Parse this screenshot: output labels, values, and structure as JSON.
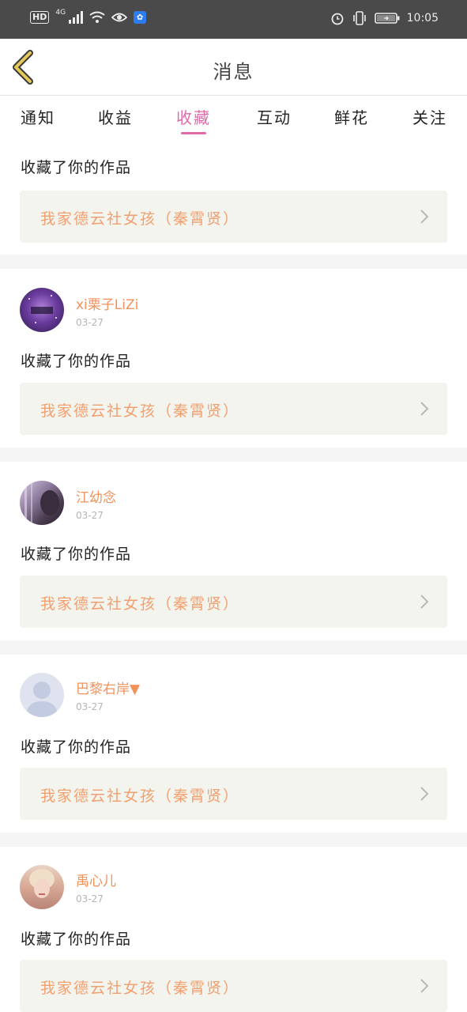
{
  "status_bar": {
    "hd": "HD",
    "network": "4G",
    "time": "10:05"
  },
  "header": {
    "title": "消息"
  },
  "tabs": [
    {
      "label": "通知"
    },
    {
      "label": "收益"
    },
    {
      "label": "收藏",
      "active": true
    },
    {
      "label": "互动"
    },
    {
      "label": "鲜花"
    },
    {
      "label": "关注"
    }
  ],
  "accent_color": "#e06aa8",
  "first_item": {
    "action": "收藏了你的作品",
    "work_title": "我家德云社女孩（秦霄贤）"
  },
  "items": [
    {
      "username": "xi栗子LiZi",
      "date": "03-27",
      "action": "收藏了你的作品",
      "work_title": "我家德云社女孩（秦霄贤）"
    },
    {
      "username": "江幼念",
      "date": "03-27",
      "action": "收藏了你的作品",
      "work_title": "我家德云社女孩（秦霄贤）"
    },
    {
      "username": "巴黎右岸▼",
      "date": "03-27",
      "action": "收藏了你的作品",
      "work_title": "我家德云社女孩（秦霄贤）"
    },
    {
      "username": "禹心儿",
      "date": "03-27",
      "action": "收藏了你的作品",
      "work_title": "我家德云社女孩（秦霄贤）"
    }
  ]
}
